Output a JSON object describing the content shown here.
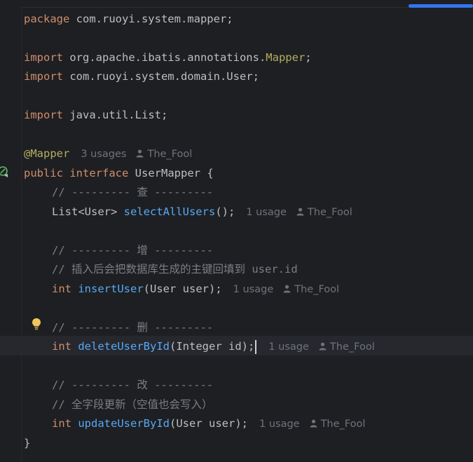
{
  "code": {
    "package_kw": "package",
    "package_name": " com.ruoyi.system.mapper;",
    "import_kw": "import",
    "import1_pre": " org.apache.ibatis.annotations.",
    "import1_cls": "Mapper",
    "import1_end": ";",
    "import2": " com.ruoyi.system.domain.User;",
    "import3": " java.util.List;",
    "annotation": "@Mapper",
    "public_kw": "public",
    "interface_kw": "interface",
    "iface_name": " UserMapper {",
    "c_query": "// --------- 查 ---------",
    "m1_ret": "List<User> ",
    "m1_name": "selectAllUsers",
    "m1_args": "();",
    "c_add": "// --------- 增 ---------",
    "c_add_note": "// 插入后会把数据库生成的主键回填到 user.id",
    "int_kw": "int",
    "m2_name": "insertUser",
    "m2_args": "(User user);",
    "c_del": "// --------- 删 ---------",
    "m3_name": "deleteUserById",
    "m3_args_a": "(Integer id)",
    "m3_args_b": ";",
    "c_upd": "// --------- 改 ---------",
    "c_upd_note": "// 全字段更新（空值也会写入）",
    "m4_name": "updateUserById",
    "m4_args": "(User user);",
    "close": "}"
  },
  "hints": {
    "class_usages": "3 usages",
    "one_usage": "1 usage",
    "author": "The_Fool"
  },
  "icons": {
    "gutter_impl": "implemented-interface-icon",
    "bulb": "lightbulb-intention-icon",
    "person": "person-icon"
  },
  "colors": {
    "background": "#1e1f22",
    "keyword": "#cf8e6d",
    "annotation": "#b3ae60",
    "method": "#56a8f5",
    "comment": "#7a7e85",
    "text": "#bcbec4",
    "accent": "#3574f0"
  }
}
